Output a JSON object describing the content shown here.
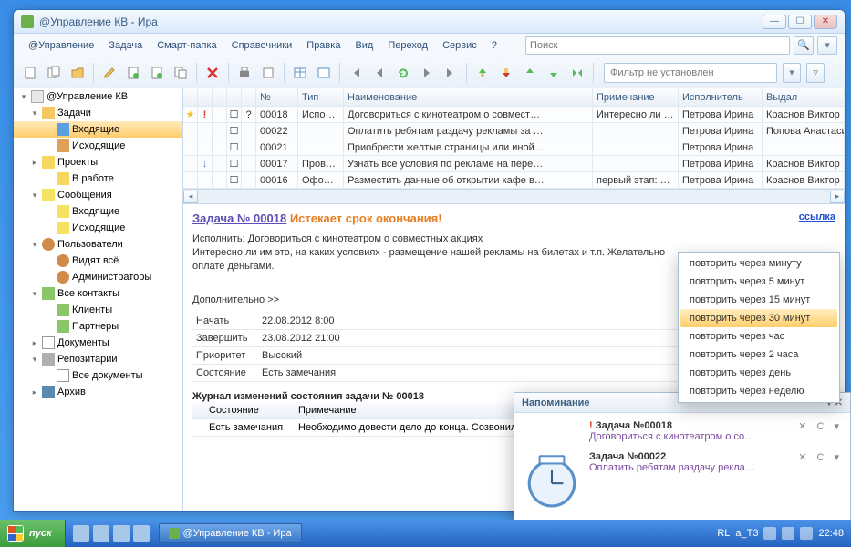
{
  "window": {
    "title": "@Управление КВ - Ира"
  },
  "menu": {
    "items": [
      "@Управление",
      "Задача",
      "Смарт-папка",
      "Справочники",
      "Правка",
      "Вид",
      "Переход",
      "Сервис",
      "?"
    ],
    "search_placeholder": "Поиск"
  },
  "toolbar": {
    "filter_placeholder": "Фильтр не установлен"
  },
  "tree": [
    {
      "l": 0,
      "exp": "▾",
      "ico": "mgr",
      "label": "@Управление КВ"
    },
    {
      "l": 1,
      "exp": "▾",
      "ico": "folder",
      "label": "Задачи"
    },
    {
      "l": 2,
      "exp": "",
      "ico": "mail",
      "label": "Входящие",
      "sel": true
    },
    {
      "l": 2,
      "exp": "",
      "ico": "out",
      "label": "Исходящие"
    },
    {
      "l": 1,
      "exp": "▸",
      "ico": "proj",
      "label": "Проекты"
    },
    {
      "l": 2,
      "exp": "",
      "ico": "proj",
      "label": "В работе"
    },
    {
      "l": 1,
      "exp": "▾",
      "ico": "msg",
      "label": "Сообщения"
    },
    {
      "l": 2,
      "exp": "",
      "ico": "msg",
      "label": "Входящие"
    },
    {
      "l": 2,
      "exp": "",
      "ico": "msg",
      "label": "Исходящие"
    },
    {
      "l": 1,
      "exp": "▾",
      "ico": "user",
      "label": "Пользователи"
    },
    {
      "l": 2,
      "exp": "",
      "ico": "user",
      "label": "Видят всё"
    },
    {
      "l": 2,
      "exp": "",
      "ico": "user",
      "label": "Администраторы"
    },
    {
      "l": 1,
      "exp": "▾",
      "ico": "cont",
      "label": "Все контакты"
    },
    {
      "l": 2,
      "exp": "",
      "ico": "cont",
      "label": "Клиенты"
    },
    {
      "l": 2,
      "exp": "",
      "ico": "cont",
      "label": "Партнеры"
    },
    {
      "l": 1,
      "exp": "▸",
      "ico": "doc",
      "label": "Документы"
    },
    {
      "l": 1,
      "exp": "▾",
      "ico": "repo",
      "label": "Репозитарии"
    },
    {
      "l": 2,
      "exp": "",
      "ico": "doc",
      "label": "Все документы"
    },
    {
      "l": 1,
      "exp": "▸",
      "ico": "arch",
      "label": "Архив"
    }
  ],
  "grid": {
    "headers": [
      "",
      "",
      "",
      "",
      "",
      "№",
      "Тип",
      "Наименование",
      "Примечание",
      "Исполнитель",
      "Выдал"
    ],
    "rows": [
      {
        "st": "★",
        "pr": "!",
        "att": "",
        "chk": "☐",
        "ic": "?",
        "num": "00018",
        "type": "Испо…",
        "name": "Договориться с кинотеатром о совмест…",
        "note": "Интересно ли …",
        "exec": "Петрова Ирина",
        "iss": "Краснов Виктор ."
      },
      {
        "st": "",
        "pr": "",
        "att": "",
        "chk": "☐",
        "ic": "",
        "num": "00022",
        "type": "",
        "name": "Оплатить ребятам раздачу рекламы за …",
        "note": "",
        "exec": "Петрова Ирина",
        "iss": "Попова Анастаси"
      },
      {
        "st": "",
        "pr": "",
        "att": "",
        "chk": "☐",
        "ic": "",
        "num": "00021",
        "type": "",
        "name": "Приобрести желтые страницы или иной …",
        "note": "",
        "exec": "Петрова Ирина",
        "iss": ""
      },
      {
        "st": "",
        "pr": "↓",
        "att": "",
        "chk": "☐",
        "ic": "",
        "num": "00017",
        "type": "Пров…",
        "name": "Узнать все условия по рекламе на пере…",
        "note": "",
        "exec": "Петрова Ирина",
        "iss": "Краснов Виктор ."
      },
      {
        "st": "",
        "pr": "",
        "att": "",
        "chk": "☐",
        "ic": "",
        "num": "00016",
        "type": "Офо…",
        "name": "Разместить данные об открытии кафе в…",
        "note": "первый этап: …",
        "exec": "Петрова Ирина",
        "iss": "Краснов Виктор ."
      }
    ]
  },
  "detail": {
    "title_link": "Задача № 00018",
    "title_warn": "Истекает срок окончания!",
    "link": "ссылка",
    "exec_label": "Исполнить",
    "exec_text": ": Договориться с кинотеатром о совместных акциях",
    "desc": "Интересно ли им это, на каких условиях - размещение нашей рекламы на билетах и т.п. Желательно",
    "desc2": "оплате деньгами.",
    "more": "Дополнительно >>",
    "fields": [
      {
        "k": "Начать",
        "v": "22.08.2012 8:00"
      },
      {
        "k": "Завершить",
        "v": "23.08.2012 21:00"
      },
      {
        "k": "Приоритет",
        "v": "Высокий"
      },
      {
        "k": "Состояние",
        "v": "Есть замечания",
        "u": true
      }
    ],
    "journal_title": "Журнал изменений состояния задачи № 00018",
    "journal_headers": [
      "",
      "Состояние",
      "Примечание"
    ],
    "journal_rows": [
      {
        "s": "",
        "state": "Есть замечания",
        "note": "Необходимо довести дело до конца. Созвонились"
      }
    ]
  },
  "notif": {
    "title": "Напоминание",
    "items": [
      {
        "excl": true,
        "title": "Задача №00018",
        "link": "Договориться с кинотеатром о со…"
      },
      {
        "excl": false,
        "title": "Задача №00022",
        "link": "Оплатить ребятам раздачу рекла…"
      }
    ]
  },
  "ctx": {
    "items": [
      "повторить через минуту",
      "повторить через 5 минут",
      "повторить через 15 минут",
      "повторить через 30 минут",
      "повторить через час",
      "повторить через 2 часа",
      "повторить через день",
      "повторить через неделю"
    ],
    "sel": 3
  },
  "taskbar": {
    "start": "пуск",
    "app": "@Управление КВ - Ира",
    "lang": "RL",
    "user": "a_T3",
    "time": "22:48"
  }
}
